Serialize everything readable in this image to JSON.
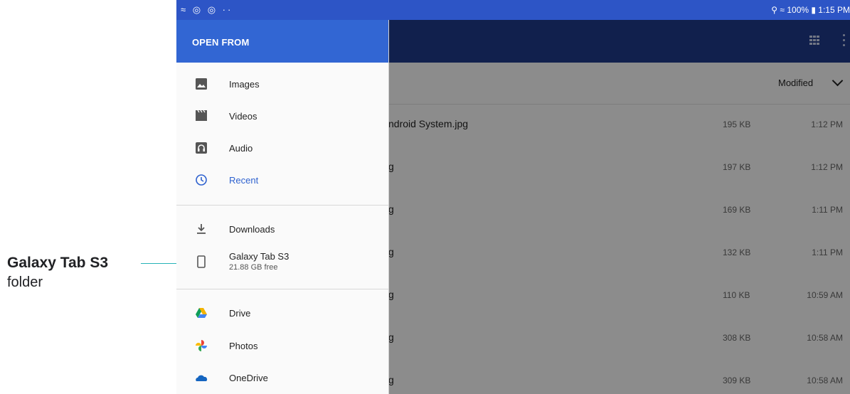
{
  "callout": {
    "title": "Galaxy Tab S3",
    "subtitle": "folder"
  },
  "statusbar": {
    "left_icons": "≈ ◎ ◎ ··",
    "right_text": "⚲ ≈ 100% ▮ 1:15 PM"
  },
  "appbar": {
    "grid_icon": "grid-view-icon",
    "more_icon": "more-vert-icon"
  },
  "sort": {
    "label": "Modified"
  },
  "files": [
    {
      "name": "ndroid System.jpg",
      "size": "195 KB",
      "time": "1:12 PM"
    },
    {
      "name": "g",
      "size": "197 KB",
      "time": "1:12 PM"
    },
    {
      "name": "g",
      "size": "169 KB",
      "time": "1:11 PM"
    },
    {
      "name": "g",
      "size": "132 KB",
      "time": "1:11 PM"
    },
    {
      "name": "g",
      "size": "110 KB",
      "time": "10:59 AM"
    },
    {
      "name": "g",
      "size": "308 KB",
      "time": "10:58 AM"
    },
    {
      "name": "g",
      "size": "309 KB",
      "time": "10:58 AM"
    }
  ],
  "drawer": {
    "title": "OPEN FROM",
    "items": [
      {
        "label": "Images",
        "icon": "image-icon"
      },
      {
        "label": "Videos",
        "icon": "video-icon"
      },
      {
        "label": "Audio",
        "icon": "audio-icon"
      },
      {
        "label": "Recent",
        "icon": "clock-icon"
      },
      {
        "label": "Downloads",
        "icon": "download-icon"
      },
      {
        "label": "Galaxy Tab S3",
        "sub": "21.88 GB free",
        "icon": "tablet-icon"
      },
      {
        "label": "Drive",
        "icon": "drive-icon"
      },
      {
        "label": "Photos",
        "icon": "photos-icon"
      },
      {
        "label": "OneDrive",
        "icon": "onedrive-icon"
      }
    ]
  },
  "colors": {
    "accent": "#3266d3",
    "statusbar": "#2d55c6",
    "appbar": "#1f3a8a",
    "callout_line": "#26b3b7",
    "recent_active": "#2f62cf"
  }
}
